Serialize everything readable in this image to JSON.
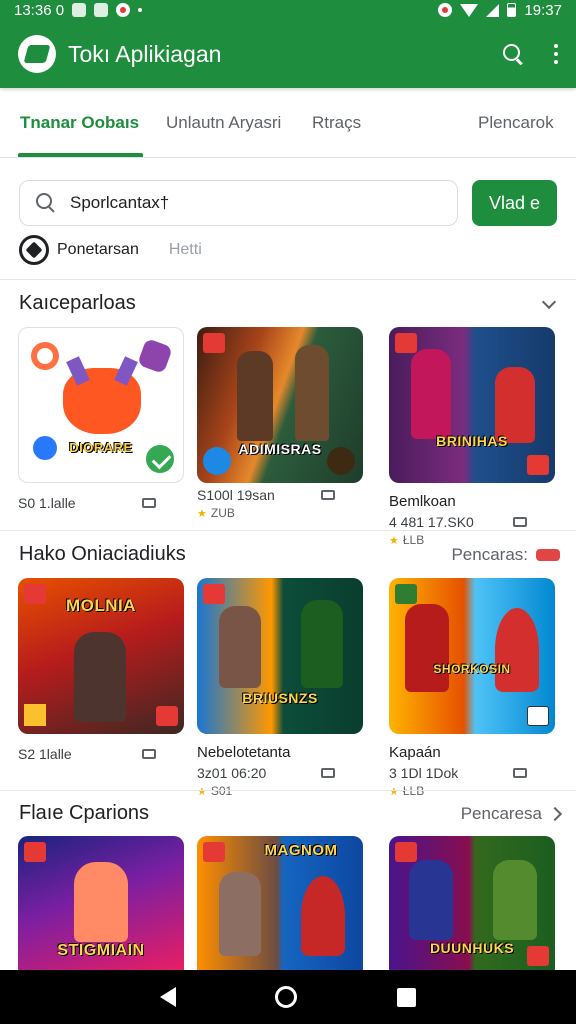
{
  "status_bar": {
    "time_left": "13:36 0",
    "time_right": "19:37"
  },
  "app_bar": {
    "title": "Tokı Aplikiagan"
  },
  "tabs": [
    {
      "label": "Tnanar Oobaıs",
      "active": true
    },
    {
      "label": "Unlautn Aryasri",
      "active": false
    },
    {
      "label": "Rtraçs",
      "active": false
    },
    {
      "label": "Plencarok",
      "active": false
    }
  ],
  "search": {
    "value": "Sporlcantax†",
    "button_label": "Vlad e"
  },
  "filter": {
    "label": "Ponetarsan",
    "sub": "Hetti"
  },
  "sections": [
    {
      "title": "Kaıceparloas",
      "more": "",
      "cards": [
        {
          "name": "",
          "meta": "S0 1.lalle",
          "rating": "",
          "art_text": "DIORARE"
        },
        {
          "name": "",
          "meta": "S100l 19san",
          "rating": "ZUB",
          "art_text": "ADIMISRAS"
        },
        {
          "name": "Bemlkoan",
          "meta": "4 481 17.SK0",
          "rating": "ŁLB",
          "art_text": "BRINIHAS"
        }
      ]
    },
    {
      "title": "Hako Oniaciadiuks",
      "more": "Pencaras:",
      "cards": [
        {
          "name": "",
          "meta": "S2 1lalle",
          "rating": "",
          "art_text": "MOLNIA"
        },
        {
          "name": "Nebelotetanta",
          "meta": "3z01 06:20",
          "rating": "S01",
          "art_text": "BRIUSNZS"
        },
        {
          "name": "Kapaán",
          "meta": "3 1Dl 1Dok",
          "rating": "ŁLB",
          "art_text": "SHORKOSIN"
        }
      ]
    },
    {
      "title": "Flaıe Cparions",
      "more": "Pencaresa",
      "cards": [
        {
          "name": "",
          "meta": "",
          "rating": "",
          "art_text": "STIGMIAIN"
        },
        {
          "name": "",
          "meta": "",
          "rating": "",
          "art_text": "MAGNOM"
        },
        {
          "name": "",
          "meta": "",
          "rating": "",
          "art_text": "DUUNHUKS"
        }
      ]
    }
  ],
  "colors": {
    "accent": "#1e8e3e",
    "badge": "#e53935",
    "star": "#f4b400"
  }
}
